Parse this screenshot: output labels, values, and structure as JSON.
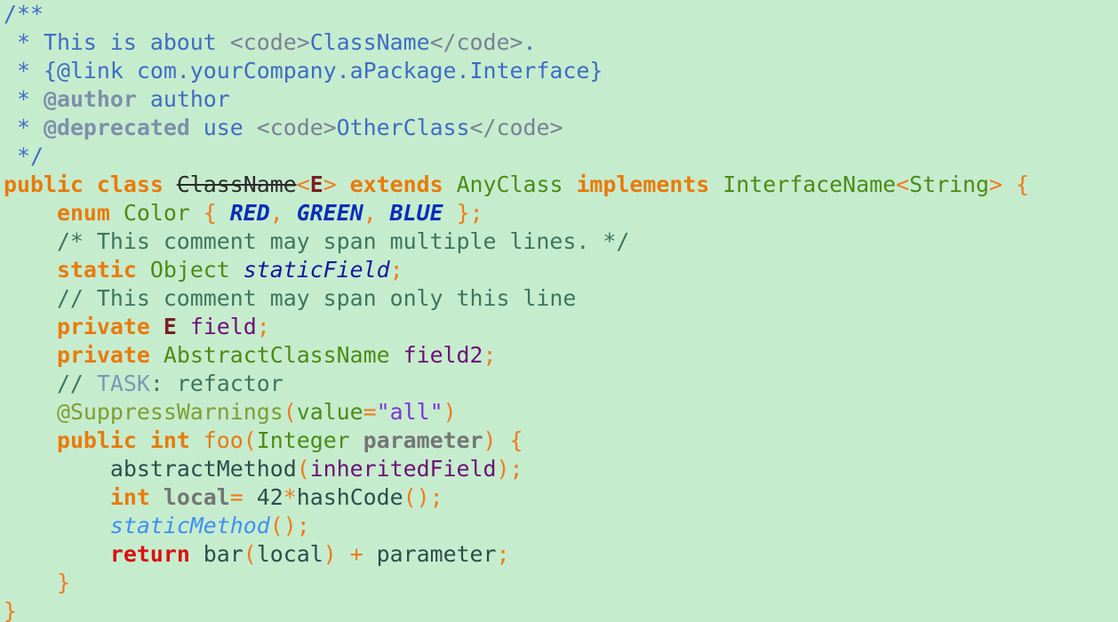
{
  "colors": {
    "background": "#c6ecce",
    "doc": "#3f6cc4",
    "doc_tag": "#7d8faa",
    "doc_markup": "#788194",
    "comment": "#3e7560",
    "keyword": "#e97a0b",
    "class_name": "#4d8b14",
    "punct": "#f07a1a",
    "enum_const": "#0a2eb8",
    "static_field": "#1515a0",
    "field": "#6d0f75",
    "type_param": "#7a1f1f",
    "todo": "#7c98b4",
    "annotation": "#7e9e34",
    "string": "#7b35d6",
    "param": "#757575",
    "method": "#2f4c4c",
    "static_method": "#3f8ff0",
    "return_kw": "#d6130f",
    "default": "#2b2b2b"
  },
  "code": {
    "lines": [
      {
        "tokens": [
          {
            "text": "/**",
            "color": "#3f6cc4"
          }
        ]
      },
      {
        "tokens": [
          {
            "text": " * This is about ",
            "color": "#3f6cc4"
          },
          {
            "text": "<code>",
            "color": "#788194"
          },
          {
            "text": "ClassName",
            "color": "#3f6cc4"
          },
          {
            "text": "</code>",
            "color": "#788194"
          },
          {
            "text": ".",
            "color": "#3f6cc4"
          }
        ]
      },
      {
        "tokens": [
          {
            "text": " * {@link com.yourCompany.aPackage.Interface}",
            "color": "#3f6cc4"
          }
        ]
      },
      {
        "tokens": [
          {
            "text": " * ",
            "color": "#3f6cc4"
          },
          {
            "text": "@author",
            "color": "#7d8faa",
            "bold": true
          },
          {
            "text": " author",
            "color": "#3f6cc4"
          }
        ]
      },
      {
        "tokens": [
          {
            "text": " * ",
            "color": "#3f6cc4"
          },
          {
            "text": "@deprecated",
            "color": "#7d8faa",
            "bold": true
          },
          {
            "text": " use ",
            "color": "#3f6cc4"
          },
          {
            "text": "<code>",
            "color": "#788194"
          },
          {
            "text": "OtherClass",
            "color": "#3f6cc4"
          },
          {
            "text": "</code>",
            "color": "#788194"
          }
        ]
      },
      {
        "tokens": [
          {
            "text": " */",
            "color": "#3f6cc4"
          }
        ]
      },
      {
        "tokens": [
          {
            "text": "public class ",
            "color": "#e97a0b",
            "bold": true
          },
          {
            "text": "ClassName",
            "color": "#2b2b2b",
            "strike": true
          },
          {
            "text": "<",
            "color": "#f07a1a"
          },
          {
            "text": "E",
            "color": "#7a1f1f",
            "bold": true
          },
          {
            "text": "> ",
            "color": "#f07a1a"
          },
          {
            "text": "extends ",
            "color": "#e97a0b",
            "bold": true
          },
          {
            "text": "AnyClass ",
            "color": "#4d8b14"
          },
          {
            "text": "implements ",
            "color": "#e97a0b",
            "bold": true
          },
          {
            "text": "InterfaceName",
            "color": "#4d8b14"
          },
          {
            "text": "<",
            "color": "#f07a1a"
          },
          {
            "text": "String",
            "color": "#4d8b14"
          },
          {
            "text": "> {",
            "color": "#f07a1a"
          }
        ]
      },
      {
        "tokens": [
          {
            "text": "    ",
            "color": "#2b2b2b"
          },
          {
            "text": "enum ",
            "color": "#e97a0b",
            "bold": true
          },
          {
            "text": "Color ",
            "color": "#4d8b14"
          },
          {
            "text": "{ ",
            "color": "#f07a1a"
          },
          {
            "text": "RED",
            "color": "#0a2eb8",
            "bold": true,
            "italic": true
          },
          {
            "text": ", ",
            "color": "#f07a1a"
          },
          {
            "text": "GREEN",
            "color": "#0a2eb8",
            "bold": true,
            "italic": true
          },
          {
            "text": ", ",
            "color": "#f07a1a"
          },
          {
            "text": "BLUE",
            "color": "#0a2eb8",
            "bold": true,
            "italic": true
          },
          {
            "text": " };",
            "color": "#f07a1a"
          }
        ]
      },
      {
        "tokens": [
          {
            "text": "    /* This comment may span multiple lines. */",
            "color": "#3e7560"
          }
        ]
      },
      {
        "tokens": [
          {
            "text": "    ",
            "color": "#2b2b2b"
          },
          {
            "text": "static ",
            "color": "#e97a0b",
            "bold": true
          },
          {
            "text": "Object ",
            "color": "#4d8b14"
          },
          {
            "text": "staticField",
            "color": "#1515a0",
            "italic": true
          },
          {
            "text": ";",
            "color": "#f07a1a"
          }
        ]
      },
      {
        "tokens": [
          {
            "text": "    // This comment may span only this line",
            "color": "#3e7560"
          }
        ]
      },
      {
        "tokens": [
          {
            "text": "    ",
            "color": "#2b2b2b"
          },
          {
            "text": "private ",
            "color": "#e97a0b",
            "bold": true
          },
          {
            "text": "E ",
            "color": "#7a1f1f",
            "bold": true
          },
          {
            "text": "field",
            "color": "#6d0f75"
          },
          {
            "text": ";",
            "color": "#f07a1a"
          }
        ]
      },
      {
        "tokens": [
          {
            "text": "    ",
            "color": "#2b2b2b"
          },
          {
            "text": "private ",
            "color": "#e97a0b",
            "bold": true
          },
          {
            "text": "AbstractClassName ",
            "color": "#4d8b14"
          },
          {
            "text": "field2",
            "color": "#6d0f75"
          },
          {
            "text": ";",
            "color": "#f07a1a"
          }
        ]
      },
      {
        "tokens": [
          {
            "text": "    // ",
            "color": "#3e7560"
          },
          {
            "text": "TASK",
            "color": "#7c98b4"
          },
          {
            "text": ": refactor",
            "color": "#3e7560"
          }
        ]
      },
      {
        "tokens": [
          {
            "text": "    ",
            "color": "#2b2b2b"
          },
          {
            "text": "@SuppressWarnings",
            "color": "#7e9e34"
          },
          {
            "text": "(",
            "color": "#f07a1a"
          },
          {
            "text": "value",
            "color": "#4d8b14"
          },
          {
            "text": "=",
            "color": "#f07a1a"
          },
          {
            "text": "\"all\"",
            "color": "#7b35d6"
          },
          {
            "text": ")",
            "color": "#f07a1a"
          }
        ]
      },
      {
        "tokens": [
          {
            "text": "    ",
            "color": "#2b2b2b"
          },
          {
            "text": "public int ",
            "color": "#e97a0b",
            "bold": true
          },
          {
            "text": "foo",
            "color": "#e97a0b"
          },
          {
            "text": "(",
            "color": "#f07a1a"
          },
          {
            "text": "Integer ",
            "color": "#4d8b14"
          },
          {
            "text": "parameter",
            "color": "#757575",
            "bold": true
          },
          {
            "text": ") {",
            "color": "#f07a1a"
          }
        ]
      },
      {
        "tokens": [
          {
            "text": "        ",
            "color": "#2b2b2b"
          },
          {
            "text": "abstractMethod",
            "color": "#2f4c4c"
          },
          {
            "text": "(",
            "color": "#f07a1a"
          },
          {
            "text": "inheritedField",
            "color": "#6d0f75"
          },
          {
            "text": ");",
            "color": "#f07a1a"
          }
        ]
      },
      {
        "tokens": [
          {
            "text": "        ",
            "color": "#2b2b2b"
          },
          {
            "text": "int ",
            "color": "#e97a0b",
            "bold": true
          },
          {
            "text": "local",
            "color": "#757575",
            "bold": true
          },
          {
            "text": "= ",
            "color": "#f07a1a"
          },
          {
            "text": "42",
            "color": "#2f4c4c"
          },
          {
            "text": "*",
            "color": "#f07a1a"
          },
          {
            "text": "hashCode",
            "color": "#2f4c4c"
          },
          {
            "text": "();",
            "color": "#f07a1a"
          }
        ]
      },
      {
        "tokens": [
          {
            "text": "        ",
            "color": "#2b2b2b"
          },
          {
            "text": "staticMethod",
            "color": "#3f8ff0",
            "italic": true
          },
          {
            "text": "();",
            "color": "#f07a1a"
          }
        ]
      },
      {
        "tokens": [
          {
            "text": "        ",
            "color": "#2b2b2b"
          },
          {
            "text": "return ",
            "color": "#d6130f",
            "bold": true
          },
          {
            "text": "bar",
            "color": "#2f4c4c"
          },
          {
            "text": "(",
            "color": "#f07a1a"
          },
          {
            "text": "local",
            "color": "#2f4c4c"
          },
          {
            "text": ") + ",
            "color": "#f07a1a"
          },
          {
            "text": "parameter",
            "color": "#2f4c4c"
          },
          {
            "text": ";",
            "color": "#f07a1a"
          }
        ]
      },
      {
        "tokens": [
          {
            "text": "    }",
            "color": "#f07a1a"
          }
        ]
      },
      {
        "tokens": [
          {
            "text": "}",
            "color": "#f07a1a"
          }
        ]
      }
    ]
  }
}
